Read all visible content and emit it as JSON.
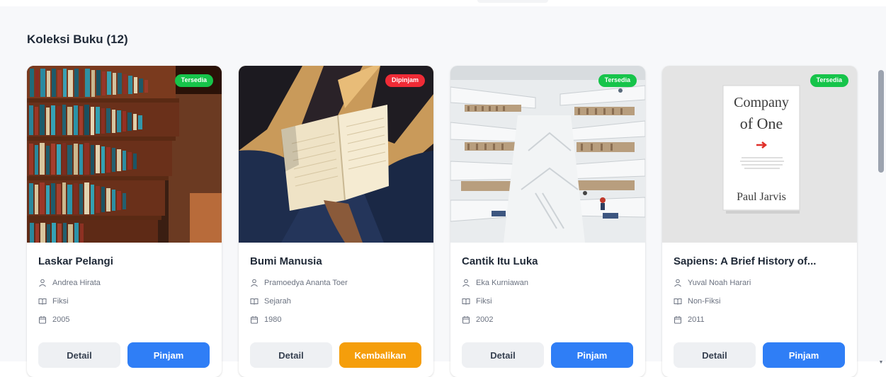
{
  "section": {
    "title": "Koleksi Buku (12)"
  },
  "books": [
    {
      "title": "Laskar Pelangi",
      "author": "Andrea Hirata",
      "category": "Fiksi",
      "year": "2005",
      "status": "Tersedia",
      "detail_label": "Detail",
      "action_label": "Pinjam"
    },
    {
      "title": "Bumi Manusia",
      "author": "Pramoedya Ananta Toer",
      "category": "Sejarah",
      "year": "1980",
      "status": "Dipinjam",
      "detail_label": "Detail",
      "action_label": "Kembalikan"
    },
    {
      "title": "Cantik Itu Luka",
      "author": "Eka Kurniawan",
      "category": "Fiksi",
      "year": "2002",
      "status": "Tersedia",
      "detail_label": "Detail",
      "action_label": "Pinjam"
    },
    {
      "title": "Sapiens: A Brief History of...",
      "author": "Yuval Noah Harari",
      "category": "Non-Fiksi",
      "year": "2011",
      "status": "Tersedia",
      "detail_label": "Detail",
      "action_label": "Pinjam"
    }
  ],
  "cover_text": {
    "line1": "Company",
    "line2": "of One",
    "author": "Paul Jarvis"
  },
  "colors": {
    "available": "#16c44a",
    "borrowed": "#ef2b36",
    "primary": "#2f7ef6",
    "return": "#f59e0b"
  }
}
